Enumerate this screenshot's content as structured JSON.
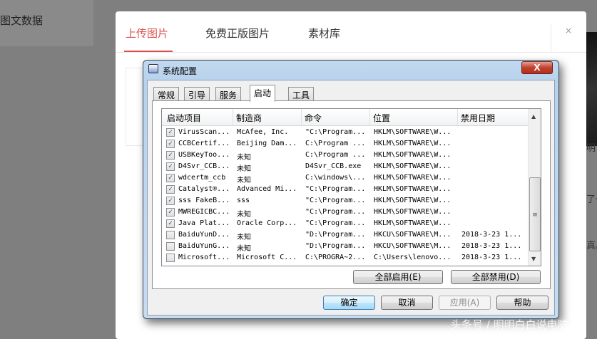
{
  "background": {
    "left_panel_label": "图文数据",
    "right_fragments": [
      "明",
      "了一",
      "真。"
    ]
  },
  "upload_modal": {
    "tabs": [
      {
        "label": "上传图片",
        "active": true
      },
      {
        "label": "免费正版图片"
      },
      {
        "label": "素材库"
      }
    ],
    "close_label": "×"
  },
  "msconfig": {
    "title": "系统配置",
    "close_label": "X",
    "tabs": [
      "常规",
      "引导",
      "服务",
      "启动",
      "工具"
    ],
    "active_tab": "启动",
    "columns": [
      "启动项目",
      "制造商",
      "命令",
      "位置",
      "禁用日期"
    ],
    "rows": [
      {
        "checked": true,
        "name": "VirusScan...",
        "maker": "McAfee, Inc.",
        "command": "\"C:\\Program...",
        "location": "HKLM\\SOFTWARE\\W...",
        "date": ""
      },
      {
        "checked": true,
        "name": "CCBCertif...",
        "maker": "Beijing Dam...",
        "command": "C:\\Program ...",
        "location": "HKLM\\SOFTWARE\\W...",
        "date": ""
      },
      {
        "checked": true,
        "name": "USBKeyToo...",
        "maker": "未知",
        "command": "C:\\Program ...",
        "location": "HKLM\\SOFTWARE\\W...",
        "date": ""
      },
      {
        "checked": true,
        "name": "D4Svr_CCB...",
        "maker": "未知",
        "command": "D4Svr_CCB.exe",
        "location": "HKLM\\SOFTWARE\\W...",
        "date": ""
      },
      {
        "checked": true,
        "name": "wdcertm_ccb",
        "maker": "未知",
        "command": "C:\\windows\\...",
        "location": "HKLM\\SOFTWARE\\W...",
        "date": ""
      },
      {
        "checked": true,
        "name": "Catalyst®...",
        "maker": "Advanced Mi...",
        "command": "\"C:\\Program...",
        "location": "HKLM\\SOFTWARE\\W...",
        "date": ""
      },
      {
        "checked": true,
        "name": "sss FakeB...",
        "maker": "sss",
        "command": "\"C:\\Program...",
        "location": "HKLM\\SOFTWARE\\W...",
        "date": ""
      },
      {
        "checked": true,
        "name": "MWREGICBC...",
        "maker": "未知",
        "command": "\"C:\\Program...",
        "location": "HKLM\\SOFTWARE\\W...",
        "date": ""
      },
      {
        "checked": true,
        "name": "Java Plat...",
        "maker": "Oracle Corp...",
        "command": "\"C:\\Program...",
        "location": "HKLM\\SOFTWARE\\W...",
        "date": ""
      },
      {
        "checked": false,
        "name": "BaiduYunD...",
        "maker": "未知",
        "command": "\"D:\\Program...",
        "location": "HKCU\\SOFTWARE\\M...",
        "date": "2018-3-23 1..."
      },
      {
        "checked": false,
        "name": "BaiduYunG...",
        "maker": "未知",
        "command": "\"D:\\Program...",
        "location": "HKCU\\SOFTWARE\\M...",
        "date": "2018-3-23 1..."
      },
      {
        "checked": false,
        "name": "Microsoft...",
        "maker": "Microsoft C...",
        "command": "C:\\PROGRA~2...",
        "location": "C:\\Users\\lenovo...",
        "date": "2018-3-23 1..."
      }
    ],
    "enable_all": "全部启用(E)",
    "disable_all": "全部禁用(D)",
    "ok": "确定",
    "cancel": "取消",
    "apply": "应用(A)",
    "help": "帮助"
  },
  "watermark": "头条号 / 明明白白说电脑"
}
